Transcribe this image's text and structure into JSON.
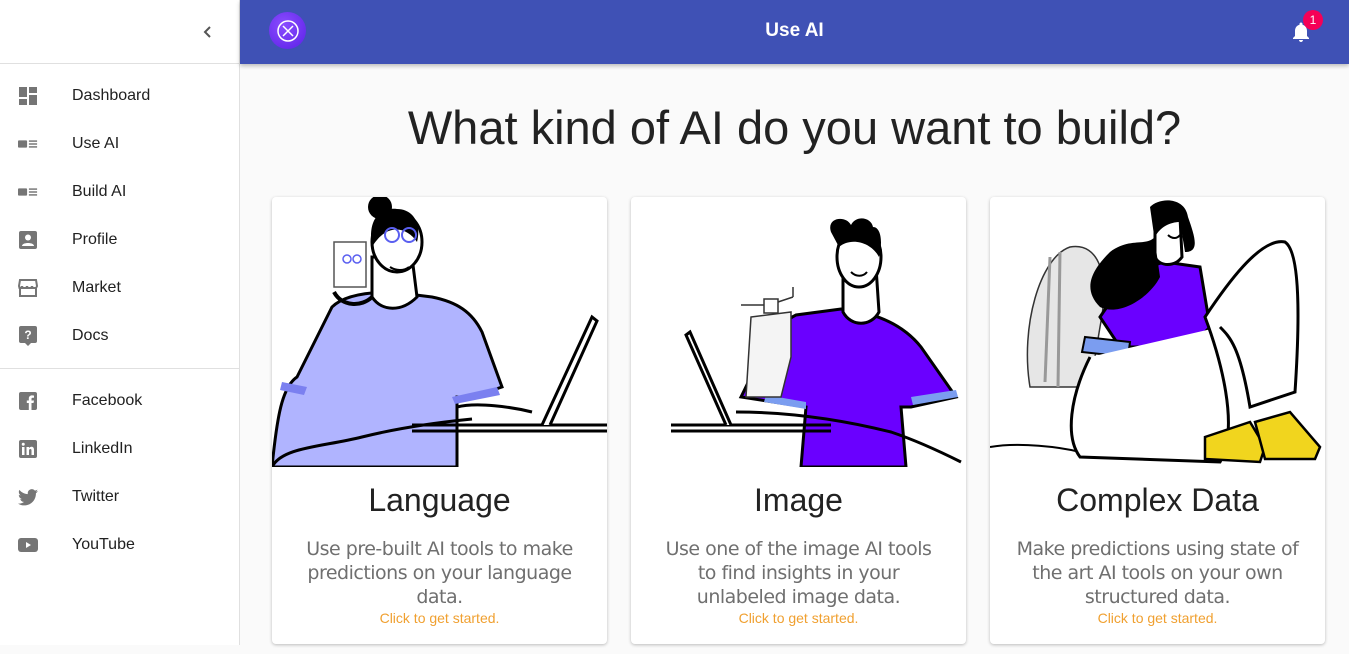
{
  "appbar": {
    "title": "Use AI",
    "notification_count": "1",
    "colors": {
      "primary": "#3f51b5",
      "badge": "#f50057",
      "logo": "#6a2df0"
    }
  },
  "sidebar": {
    "collapse_icon": "chevron-left-icon",
    "main_items": [
      {
        "label": "Dashboard",
        "icon": "dashboard-icon"
      },
      {
        "label": "Use AI",
        "icon": "featured-video-icon"
      },
      {
        "label": "Build AI",
        "icon": "featured-video-icon"
      },
      {
        "label": "Profile",
        "icon": "account-box-icon"
      },
      {
        "label": "Market",
        "icon": "store-icon"
      },
      {
        "label": "Docs",
        "icon": "help-icon"
      }
    ],
    "social_items": [
      {
        "label": "Facebook",
        "icon": "facebook-icon"
      },
      {
        "label": "LinkedIn",
        "icon": "linkedin-icon"
      },
      {
        "label": "Twitter",
        "icon": "twitter-icon"
      },
      {
        "label": "YouTube",
        "icon": "youtube-icon"
      }
    ]
  },
  "main": {
    "heading": "What kind of AI do you want to build?",
    "cards": [
      {
        "title": "Language",
        "description": "Use pre-built AI tools to make predictions on your language data.",
        "cta": "Click to get started.",
        "shirt_color": "#b0b4ff"
      },
      {
        "title": "Image",
        "description": "Use one of the image AI tools to find insights in your unlabeled image data.",
        "cta": "Click to get started.",
        "shirt_color": "#6a00ff"
      },
      {
        "title": "Complex Data",
        "description": "Make predictions using state of the art AI tools on your own structured data.",
        "cta": "Click to get started.",
        "shirt_color": "#6a00ff"
      }
    ]
  }
}
